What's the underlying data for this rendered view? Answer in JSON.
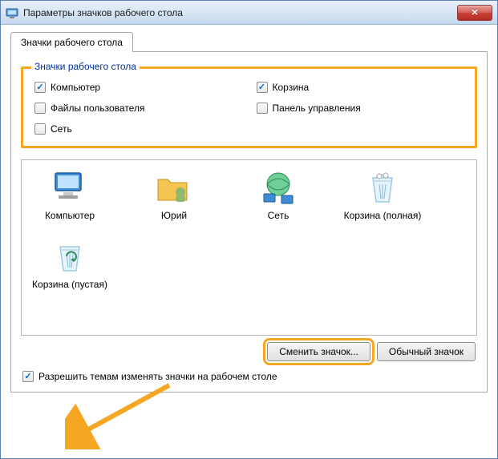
{
  "titlebar": {
    "title": "Параметры значков рабочего стола"
  },
  "tab": {
    "label": "Значки рабочего стола"
  },
  "groupbox": {
    "legend": "Значки рабочего стола",
    "checkboxes": {
      "computer": {
        "label": "Компьютер",
        "checked": true
      },
      "recycle": {
        "label": "Корзина",
        "checked": true
      },
      "userfiles": {
        "label": "Файлы пользователя",
        "checked": false
      },
      "cpanel": {
        "label": "Панель управления",
        "checked": false
      },
      "network": {
        "label": "Сеть",
        "checked": false
      }
    }
  },
  "icons": {
    "computer": "Компьютер",
    "user": "Юрий",
    "network": "Сеть",
    "binfull": "Корзина (полная)",
    "binempty": "Корзина (пустая)"
  },
  "buttons": {
    "change": "Сменить значок...",
    "default": "Обычный значок"
  },
  "allow_themes": {
    "label": "Разрешить темам изменять значки на рабочем столе",
    "checked": true
  },
  "colors": {
    "highlight": "#f5a623"
  }
}
